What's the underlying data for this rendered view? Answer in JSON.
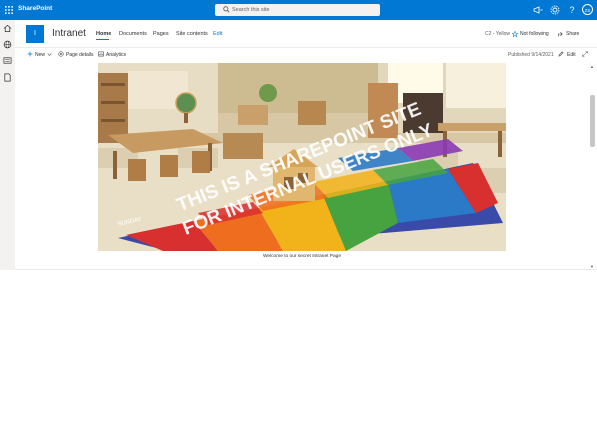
{
  "suite_bar": {
    "app_name": "SharePoint",
    "search_placeholder": "Search this site",
    "avatar_initials": "ZS",
    "accent": "#0078d4",
    "icons": [
      "megaphone-icon",
      "gear-icon",
      "help-icon"
    ]
  },
  "left_rail": {
    "icons": [
      "home-icon",
      "globe-icon",
      "news-icon",
      "document-icon"
    ]
  },
  "site": {
    "logo_letter": "I",
    "title": "Intranet",
    "nav": [
      "Home",
      "Documents",
      "Pages",
      "Site contents",
      "Edit"
    ],
    "active_nav": "Home"
  },
  "header_right": {
    "label": "C2 - Yellow",
    "follow": "Not following",
    "share": "Share"
  },
  "command_bar": {
    "new_label": "New",
    "page_details_label": "Page details",
    "analytics_label": "Analytics",
    "published": "Published 9/14/2021",
    "edit_label": "Edit"
  },
  "hero": {
    "overlay_line1": "THIS IS A SHAREPOINT SITE",
    "overlay_line2": "FOR INTERNAL USERS ONLY",
    "rug_text": "SUNDAY",
    "caption": "Welcome to our secret Intranet Page"
  }
}
